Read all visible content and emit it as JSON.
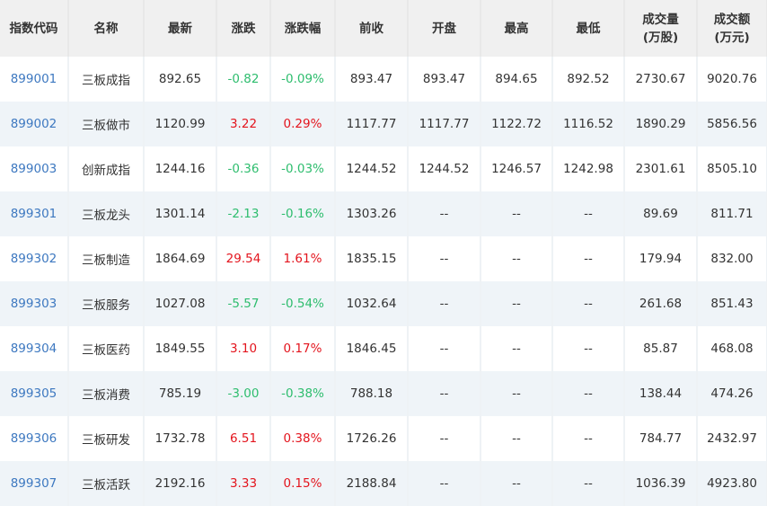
{
  "headers": [
    "指数代码",
    "名称",
    "最新",
    "涨跌",
    "涨跌幅",
    "前收",
    "开盘",
    "最高",
    "最低",
    "成交量\n(万股)",
    "成交额\n(万元)"
  ],
  "header_lines": [
    [
      "成交量",
      "(万股)"
    ],
    [
      "成交额",
      "(万元)"
    ]
  ],
  "colors": {
    "up": "#e3141d",
    "down": "#2ebd6e",
    "code": "#3d78c0"
  },
  "rows": [
    [
      "899001",
      "三板成指",
      "892.65",
      "-0.82",
      "-0.09%",
      "893.47",
      "893.47",
      "894.65",
      "892.52",
      "2730.67",
      "9020.76"
    ],
    [
      "899002",
      "三板做市",
      "1120.99",
      "3.22",
      "0.29%",
      "1117.77",
      "1117.77",
      "1122.72",
      "1116.52",
      "1890.29",
      "5856.56"
    ],
    [
      "899003",
      "创新成指",
      "1244.16",
      "-0.36",
      "-0.03%",
      "1244.52",
      "1244.52",
      "1246.57",
      "1242.98",
      "2301.61",
      "8505.10"
    ],
    [
      "899301",
      "三板龙头",
      "1301.14",
      "-2.13",
      "-0.16%",
      "1303.26",
      "--",
      "--",
      "--",
      "89.69",
      "811.71"
    ],
    [
      "899302",
      "三板制造",
      "1864.69",
      "29.54",
      "1.61%",
      "1835.15",
      "--",
      "--",
      "--",
      "179.94",
      "832.00"
    ],
    [
      "899303",
      "三板服务",
      "1027.08",
      "-5.57",
      "-0.54%",
      "1032.64",
      "--",
      "--",
      "--",
      "261.68",
      "851.43"
    ],
    [
      "899304",
      "三板医药",
      "1849.55",
      "3.10",
      "0.17%",
      "1846.45",
      "--",
      "--",
      "--",
      "85.87",
      "468.08"
    ],
    [
      "899305",
      "三板消费",
      "785.19",
      "-3.00",
      "-0.38%",
      "788.18",
      "--",
      "--",
      "--",
      "138.44",
      "474.26"
    ],
    [
      "899306",
      "三板研发",
      "1732.78",
      "6.51",
      "0.38%",
      "1726.26",
      "--",
      "--",
      "--",
      "784.77",
      "2432.97"
    ],
    [
      "899307",
      "三板活跃",
      "2192.16",
      "3.33",
      "0.15%",
      "2188.84",
      "--",
      "--",
      "--",
      "1036.39",
      "4923.80"
    ]
  ]
}
